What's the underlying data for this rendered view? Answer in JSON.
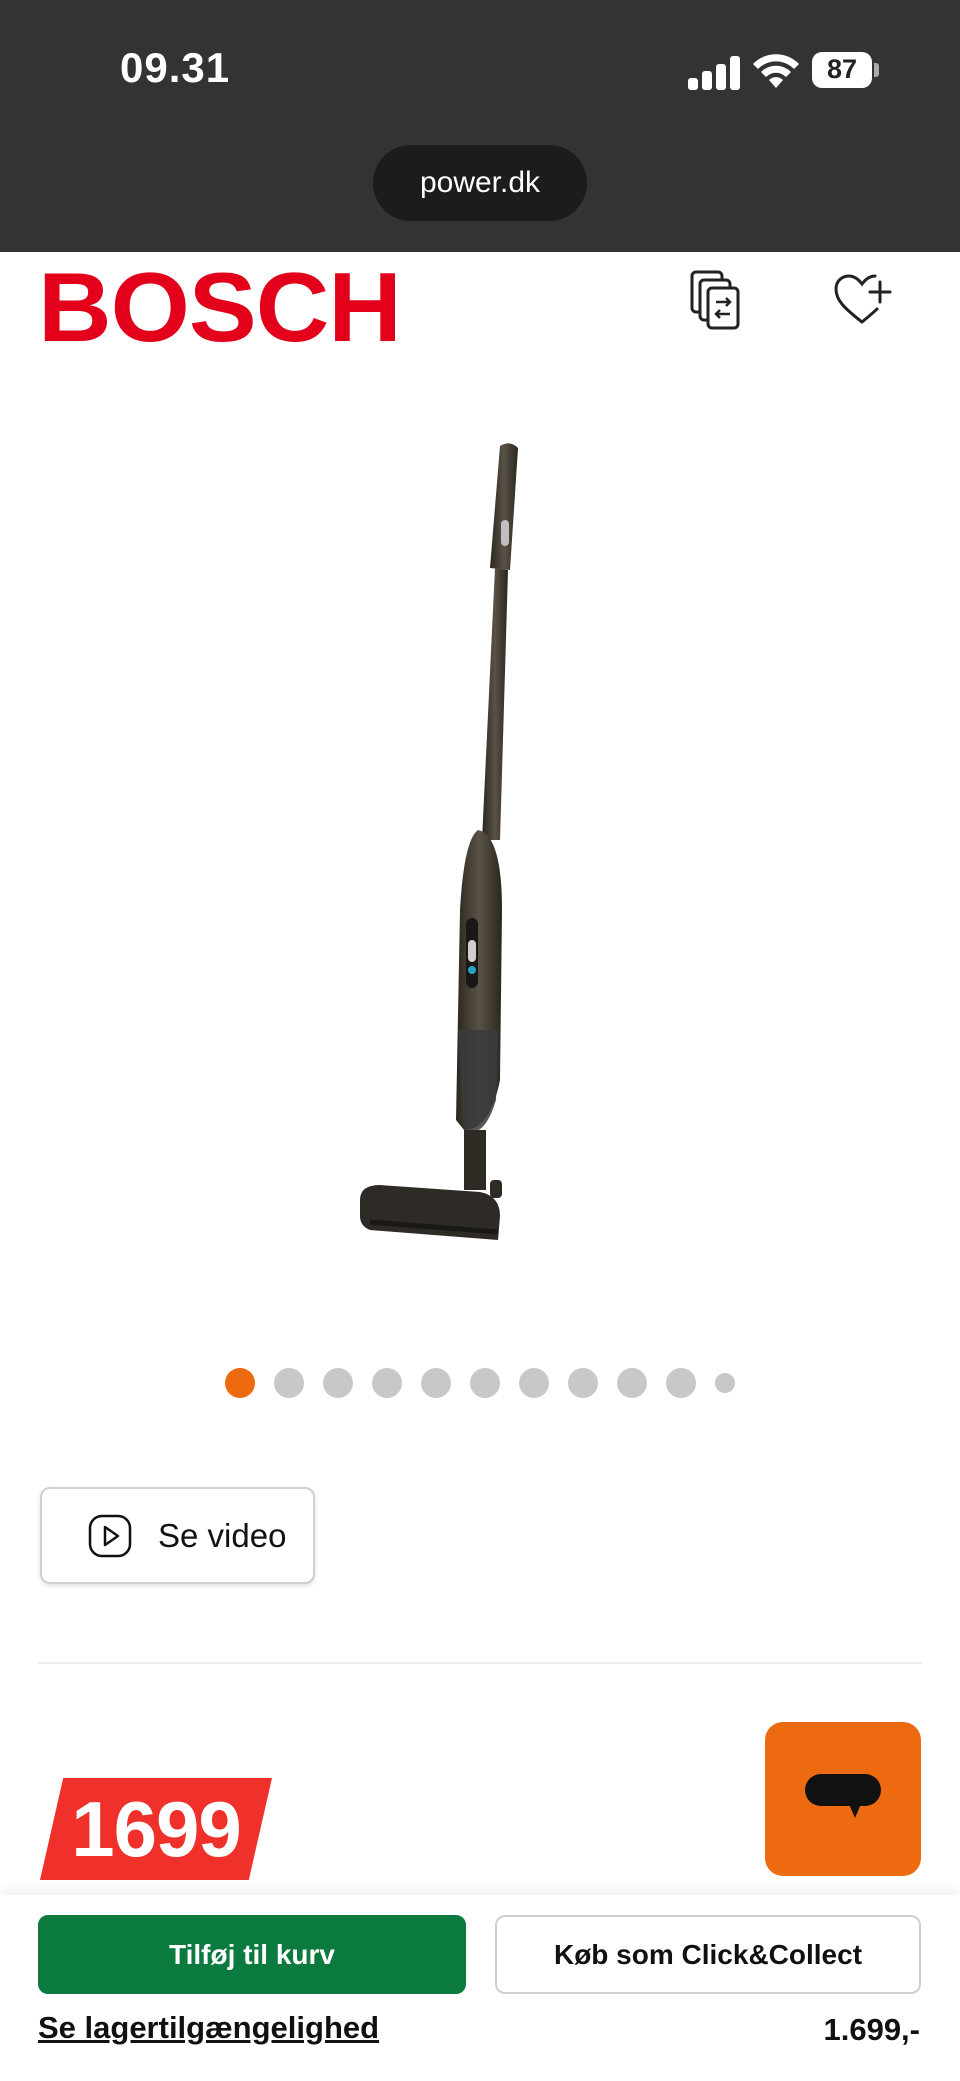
{
  "status_bar": {
    "time": "09.31",
    "battery": "87",
    "url": "power.dk"
  },
  "header": {
    "brand": "BOSCH",
    "brand_color": "#e2001a",
    "icons": [
      "compare-icon",
      "heart-add-icon"
    ]
  },
  "product_image": {
    "alt": "Bosch stick vacuum"
  },
  "carousel": {
    "total_dots": 11,
    "active_index": 0,
    "active_color": "#ee6a10"
  },
  "video_button": {
    "label": "Se video",
    "icon": "play-icon"
  },
  "price": {
    "badge": "1699",
    "badge_color": "#f0302a"
  },
  "chat": {
    "icon": "chat-icon",
    "color": "#ee6a10"
  },
  "bottom_bar": {
    "add_to_cart": "Tilføj til kurv",
    "click_collect": "Køb som Click&Collect",
    "stock_link": "Se lagertilgængelighed",
    "total": "1.699,-",
    "cart_color": "#0b7a3e"
  }
}
